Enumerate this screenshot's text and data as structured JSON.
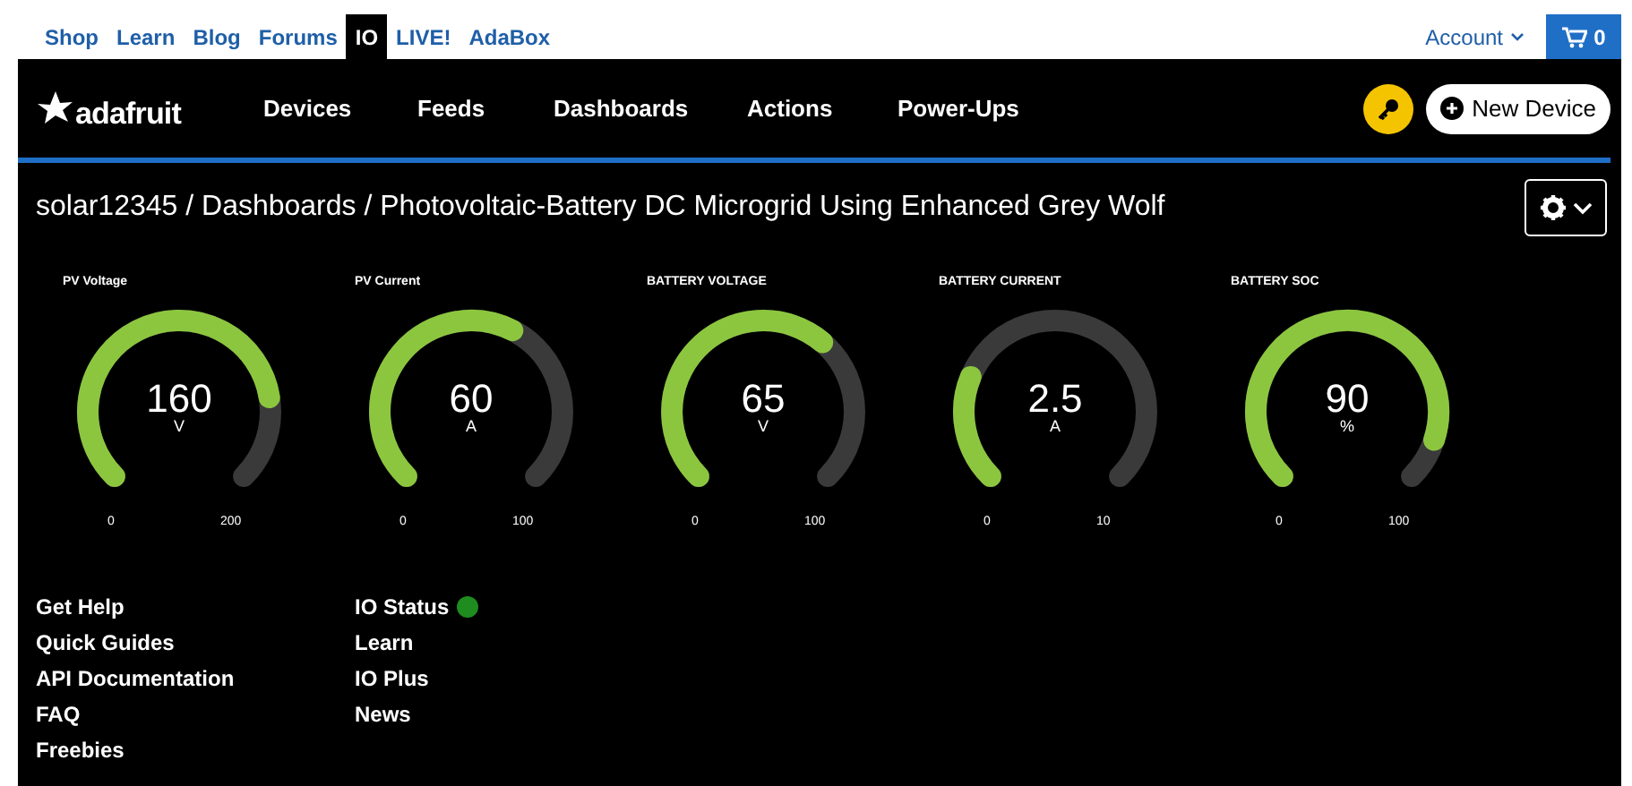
{
  "top_nav": {
    "items": [
      {
        "label": "Shop",
        "selected": false
      },
      {
        "label": "Learn",
        "selected": false
      },
      {
        "label": "Blog",
        "selected": false
      },
      {
        "label": "Forums",
        "selected": false
      },
      {
        "label": "IO",
        "selected": true
      },
      {
        "label": "LIVE!",
        "selected": false
      },
      {
        "label": "AdaBox",
        "selected": false
      }
    ],
    "account": "Account",
    "cart_count": "0"
  },
  "header": {
    "logo": "adafruit",
    "nav": [
      "Devices",
      "Feeds",
      "Dashboards",
      "Actions",
      "Power-Ups"
    ],
    "new_device_button": "New Device"
  },
  "breadcrumb": "solar12345 / Dashboards / Photovoltaic-Battery DC Microgrid Using Enhanced Grey Wolf",
  "gauges": [
    {
      "title": "PV Voltage",
      "value": "160",
      "unit": "V",
      "min": "0",
      "max": "200"
    },
    {
      "title": "PV Current",
      "value": "60",
      "unit": "A",
      "min": "0",
      "max": "100"
    },
    {
      "title": "BATTERY VOLTAGE",
      "value": "65",
      "unit": "V",
      "min": "0",
      "max": "100"
    },
    {
      "title": "BATTERY CURRENT",
      "value": "2.5",
      "unit": "A",
      "min": "0",
      "max": "10"
    },
    {
      "title": "BATTERY SOC",
      "value": "90",
      "unit": "%",
      "min": "0",
      "max": "100"
    }
  ],
  "footer": {
    "column_1": [
      {
        "label": "Get Help"
      },
      {
        "label": "Quick Guides"
      },
      {
        "label": "API Documentation"
      },
      {
        "label": "FAQ"
      },
      {
        "label": "Freebies"
      }
    ],
    "column_2": [
      {
        "label": "IO Status",
        "color": "#1e8c1e"
      },
      {
        "label": "Learn"
      },
      {
        "label": "IO Plus"
      },
      {
        "label": "News"
      }
    ]
  }
}
